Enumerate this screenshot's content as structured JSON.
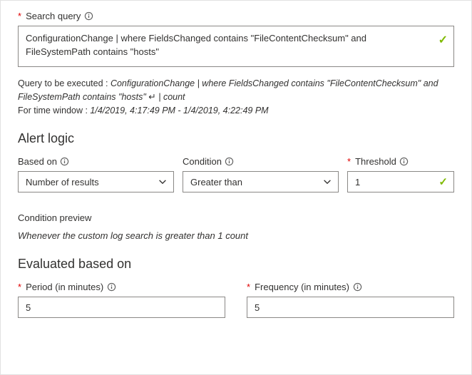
{
  "searchQuery": {
    "label": "Search query",
    "value": "ConfigurationChange | where FieldsChanged contains \"FileContentChecksum\" and FileSystemPath contains \"hosts\""
  },
  "queryDescription": {
    "prefix": "Query to be executed : ",
    "query_part1": "ConfigurationChange | where FieldsChanged contains \"FileContentChecksum\" and FileSystemPath contains \"hosts\" ",
    "query_part2": "| count",
    "timePrefix": "For time window : ",
    "timeWindow": "1/4/2019, 4:17:49 PM - 1/4/2019, 4:22:49 PM"
  },
  "alertLogic": {
    "heading": "Alert logic",
    "basedOn": {
      "label": "Based on",
      "value": "Number of results"
    },
    "condition": {
      "label": "Condition",
      "value": "Greater than"
    },
    "threshold": {
      "label": "Threshold",
      "value": "1"
    }
  },
  "conditionPreview": {
    "label": "Condition preview",
    "text": "Whenever the custom log search is greater than 1 count"
  },
  "evaluated": {
    "heading": "Evaluated based on",
    "period": {
      "label": "Period (in minutes)",
      "value": "5"
    },
    "frequency": {
      "label": "Frequency (in minutes)",
      "value": "5"
    }
  }
}
